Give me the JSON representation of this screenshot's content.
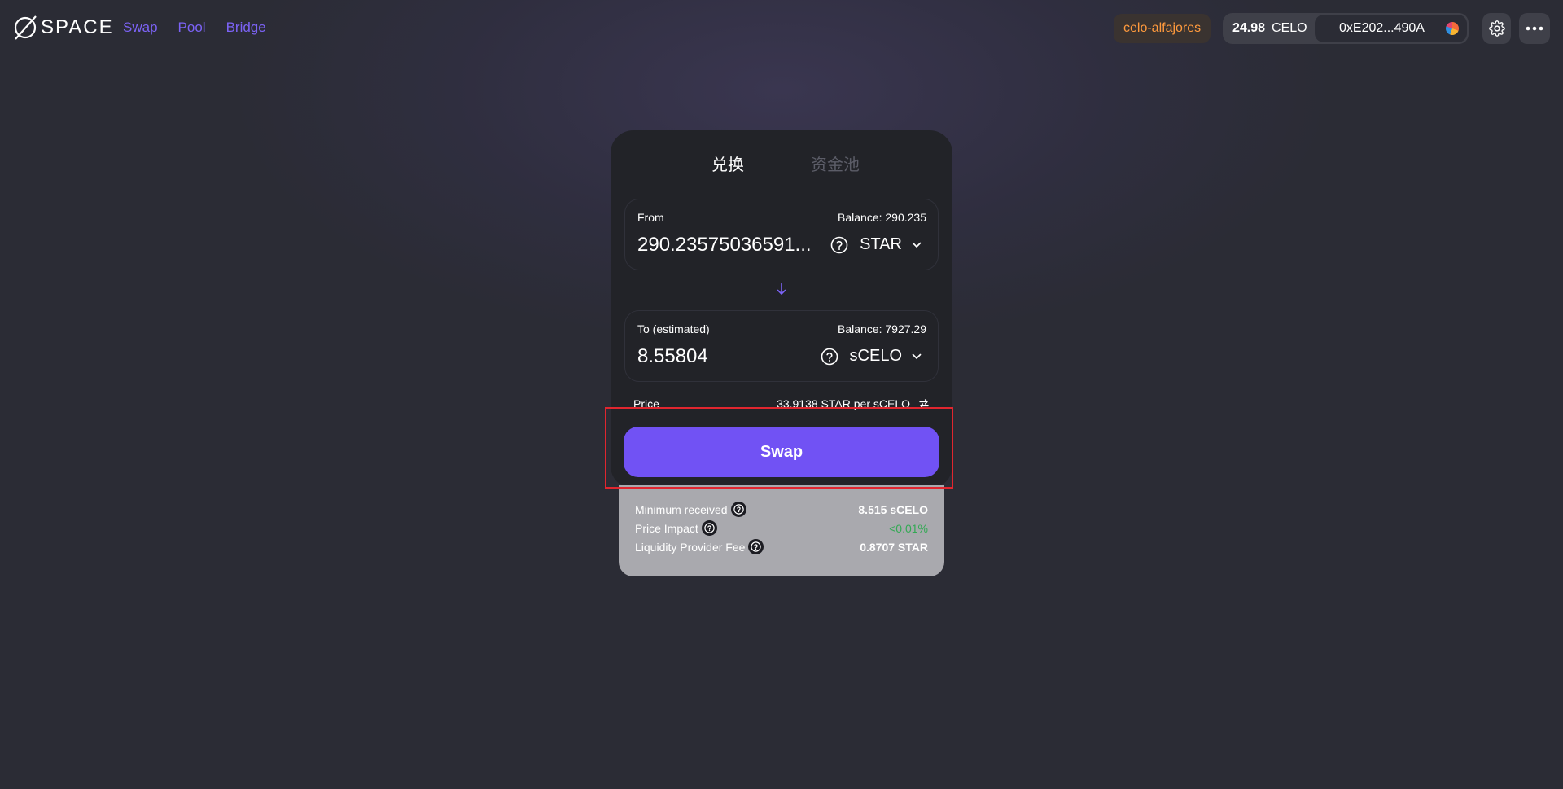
{
  "header": {
    "logo_text": "SPACE",
    "nav": [
      {
        "label": "Swap"
      },
      {
        "label": "Pool"
      },
      {
        "label": "Bridge"
      }
    ],
    "network": "celo-alfajores",
    "account": {
      "balance_amount": "24.98",
      "balance_unit": "CELO",
      "address": "0xE202...490A"
    },
    "icons": [
      "gear-icon",
      "more-icon"
    ]
  },
  "card": {
    "tabs": [
      {
        "label": "兑换",
        "active": true
      },
      {
        "label": "资金池",
        "active": false
      }
    ],
    "from": {
      "label": "From",
      "balance": "Balance: 290.235",
      "amount": "290.23575036591...",
      "token": "STAR"
    },
    "to": {
      "label": "To (estimated)",
      "balance": "Balance: 7927.29",
      "amount": "8.55804",
      "token": "sCELO"
    },
    "price": {
      "label": "Price",
      "value": "33.9138 STAR per sCELO"
    },
    "swap_label": "Swap"
  },
  "details": [
    {
      "label": "Minimum received",
      "value": "8.515 sCELO"
    },
    {
      "label": "Price Impact",
      "value": "<0.01%"
    },
    {
      "label": "Liquidity Provider Fee",
      "value": "0.8707 STAR"
    }
  ],
  "colors": {
    "accent": "#7152f4",
    "nav_link": "#7c63f6",
    "network": "#ff9a3d",
    "price_impact": "#33a954",
    "highlight": "#e0262f"
  }
}
